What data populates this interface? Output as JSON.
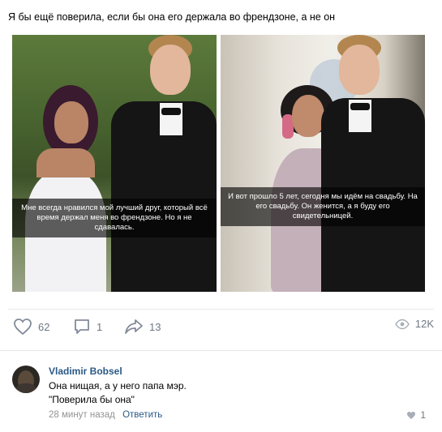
{
  "post": {
    "text": "Я бы ещё поверила, если бы она его держала во френдзоне, а не он",
    "photos": [
      {
        "caption": "Мне всегда нравился мой лучший друг, который всё время держал меня во френдзоне. Но я не сдавалась."
      },
      {
        "caption": "И вот прошло 5 лет, сегодня мы идём на свадьбу. На его свадьбу. Он женится, а я буду его свидетельницей."
      }
    ],
    "actions": {
      "likes": "62",
      "comments": "1",
      "shares": "13",
      "views": "12K"
    }
  },
  "comment": {
    "author": "Vladimir Bobsel",
    "line1": "Она нищая, а у него папа мэр.",
    "line2": "\"Поверила бы она\"",
    "time": "28 минут назад",
    "reply": "Ответить",
    "likes": "1"
  },
  "colors": {
    "link": "#2a5885",
    "muted": "#6d7885",
    "divider": "#e7e8ec"
  }
}
